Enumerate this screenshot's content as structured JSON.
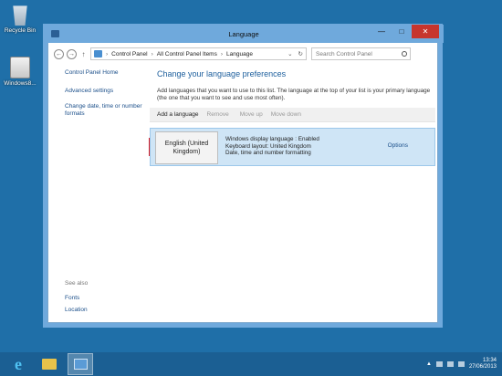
{
  "desktop": {
    "icons": [
      {
        "label": "Recycle Bin"
      },
      {
        "label": "Windows8..."
      }
    ]
  },
  "window": {
    "title": "Language",
    "buttons": {
      "minimize": "—",
      "maximize": "□",
      "close": "✕"
    }
  },
  "address": {
    "path": [
      "Control Panel",
      "All Control Panel Items",
      "Language"
    ],
    "search_placeholder": "Search Control Panel"
  },
  "left_pane": {
    "home": "Control Panel Home",
    "links": [
      "Advanced settings",
      "Change date, time or number formats"
    ],
    "see_also_header": "See also",
    "see_also_links": [
      "Fonts",
      "Location"
    ]
  },
  "main": {
    "heading": "Change your language preferences",
    "intro": "Add languages that you want to use to this list. The language at the top of your list is your primary language (the one that you want to see and use most often).",
    "toolbar": {
      "add": "Add a language",
      "remove": "Remove",
      "move_up": "Move up",
      "move_down": "Move down"
    },
    "language": {
      "name": "English (United Kingdom)",
      "details": [
        "Windows display language : Enabled",
        "Keyboard layout: United Kingdom",
        "Date, time and number formatting"
      ],
      "options": "Options"
    }
  },
  "taskbar": {
    "time": "13:34",
    "date": "27/06/2013"
  }
}
